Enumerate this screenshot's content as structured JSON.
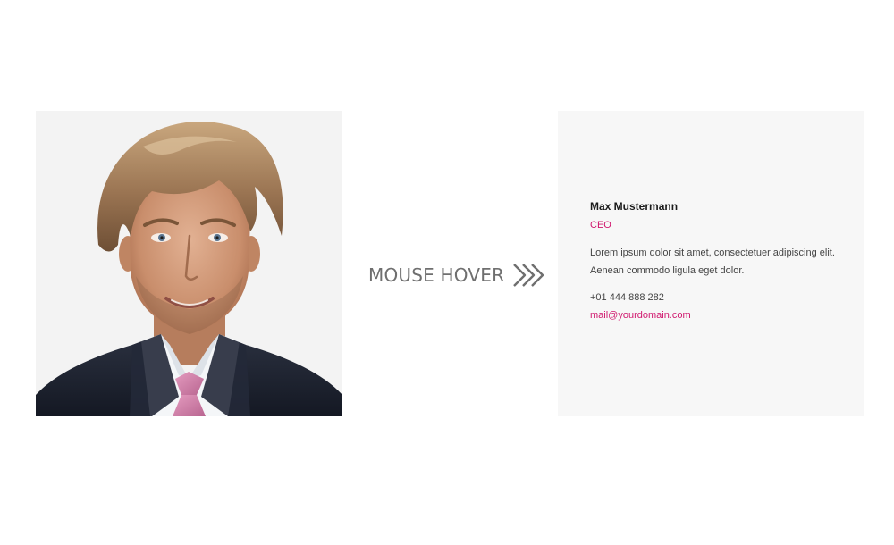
{
  "photo": {
    "tie_color": "#d383ab",
    "suit_color": "#1e2330",
    "background_color": "#f3f3f3"
  },
  "hover_indicator": {
    "label": "MOUSE HOVER",
    "icon": "double-chevron-right-icon",
    "color": "#6f6f6f"
  },
  "team_card": {
    "name": "Max Mustermann",
    "role": "CEO",
    "bio": "Lorem ipsum dolor sit amet, consectetuer adipiscing elit. Aenean commodo ligula eget dolor.",
    "phone": "+01 444 888 282",
    "email": "mail@yourdomain.com",
    "accent_color": "#d0186e",
    "background_color": "#f7f7f7"
  }
}
